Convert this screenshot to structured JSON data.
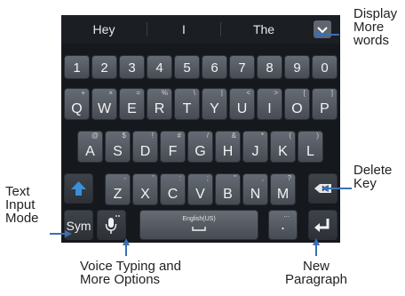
{
  "suggestions": [
    "Hey",
    "I",
    "The"
  ],
  "number_row": [
    "1",
    "2",
    "3",
    "4",
    "5",
    "6",
    "7",
    "8",
    "9",
    "0"
  ],
  "row_qwerty": [
    {
      "main": "Q",
      "sub": "+"
    },
    {
      "main": "W",
      "sub": "×"
    },
    {
      "main": "E",
      "sub": "="
    },
    {
      "main": "R",
      "sub": "%"
    },
    {
      "main": "T",
      "sub": "\\"
    },
    {
      "main": "Y",
      "sub": "|"
    },
    {
      "main": "U",
      "sub": "<"
    },
    {
      "main": "I",
      "sub": ">"
    },
    {
      "main": "O",
      "sub": "["
    },
    {
      "main": "P",
      "sub": "]"
    }
  ],
  "row_asdf": [
    {
      "main": "A",
      "sub": "@"
    },
    {
      "main": "S",
      "sub": "$"
    },
    {
      "main": "D",
      "sub": "!"
    },
    {
      "main": "F",
      "sub": "#"
    },
    {
      "main": "G",
      "sub": "/"
    },
    {
      "main": "H",
      "sub": "&"
    },
    {
      "main": "J",
      "sub": "*"
    },
    {
      "main": "K",
      "sub": "("
    },
    {
      "main": "L",
      "sub": ")"
    }
  ],
  "row_zxcv": [
    {
      "main": "Z",
      "sub": "-"
    },
    {
      "main": "X",
      "sub": "'"
    },
    {
      "main": "C",
      "sub": ":"
    },
    {
      "main": "V",
      "sub": ";"
    },
    {
      "main": "B",
      "sub": "\""
    },
    {
      "main": "N",
      "sub": ","
    },
    {
      "main": "M",
      "sub": "?"
    }
  ],
  "bottom_row": {
    "sym_label": "Sym",
    "space_label": "English(US)",
    "period": ".",
    "period_sub": "..."
  },
  "callouts": {
    "display_more": [
      "Display",
      "More",
      "words"
    ],
    "delete_key": [
      "Delete",
      "Key"
    ],
    "text_input_mode": [
      "Text",
      "Input",
      "Mode"
    ],
    "voice_typing": [
      "Voice Typing and",
      "More Options"
    ],
    "new_paragraph": [
      "New",
      "Paragraph"
    ]
  },
  "colors": {
    "keyboard_bg": "#15181d",
    "key": "#565c64",
    "shift_accent": "#3a8fd8",
    "callout_line": "#3b6fb6"
  }
}
